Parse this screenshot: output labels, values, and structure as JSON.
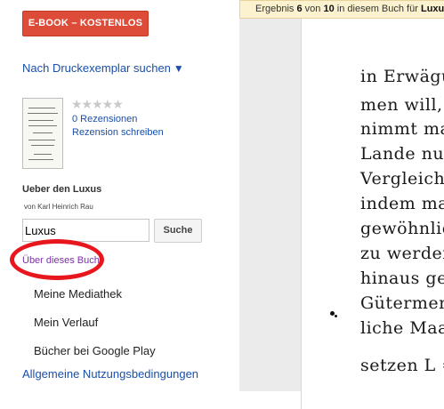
{
  "sidebar": {
    "ebook_button": "E-BOOK – KOSTENLOS",
    "print_link": "Nach Druckexemplar suchen",
    "print_arrow": "▼",
    "rating_stars": "★★★★★",
    "reviews": "0 Rezensionen",
    "write_review": "Rezension schreiben",
    "book_title": "Ueber den Luxus",
    "author": "von Karl Heinrich Rau",
    "search_value": "Luxus",
    "search_button": "Suche",
    "about_link": "Über dieses Buch",
    "nav": [
      "Meine Mediathek",
      "Mein Verlauf",
      "Bücher bei Google Play"
    ],
    "terms_link": "Allgemeine Nutzungsbedingungen"
  },
  "result_bar": {
    "prefix": "Ergebnis",
    "current": "6",
    "middle": "von",
    "total": "10",
    "suffix": "in diesem Buch für",
    "query": "Luxus"
  },
  "scan_text": [
    "in Erwägu",
    "men will,",
    "nimmt ma",
    "Lande nur",
    "Vergleiche",
    "indem ma",
    "gewöhnlich",
    "zu werden",
    "hinaus geh",
    "Gütermen",
    "liche Maa",
    "setzen  L ="
  ],
  "colors": {
    "ebook_button": "#dd4b39",
    "link": "#1a4fa8",
    "visited_link": "#7b2fa8",
    "highlight_ring": "#e8161d",
    "result_bar": "#fcf2cf"
  }
}
